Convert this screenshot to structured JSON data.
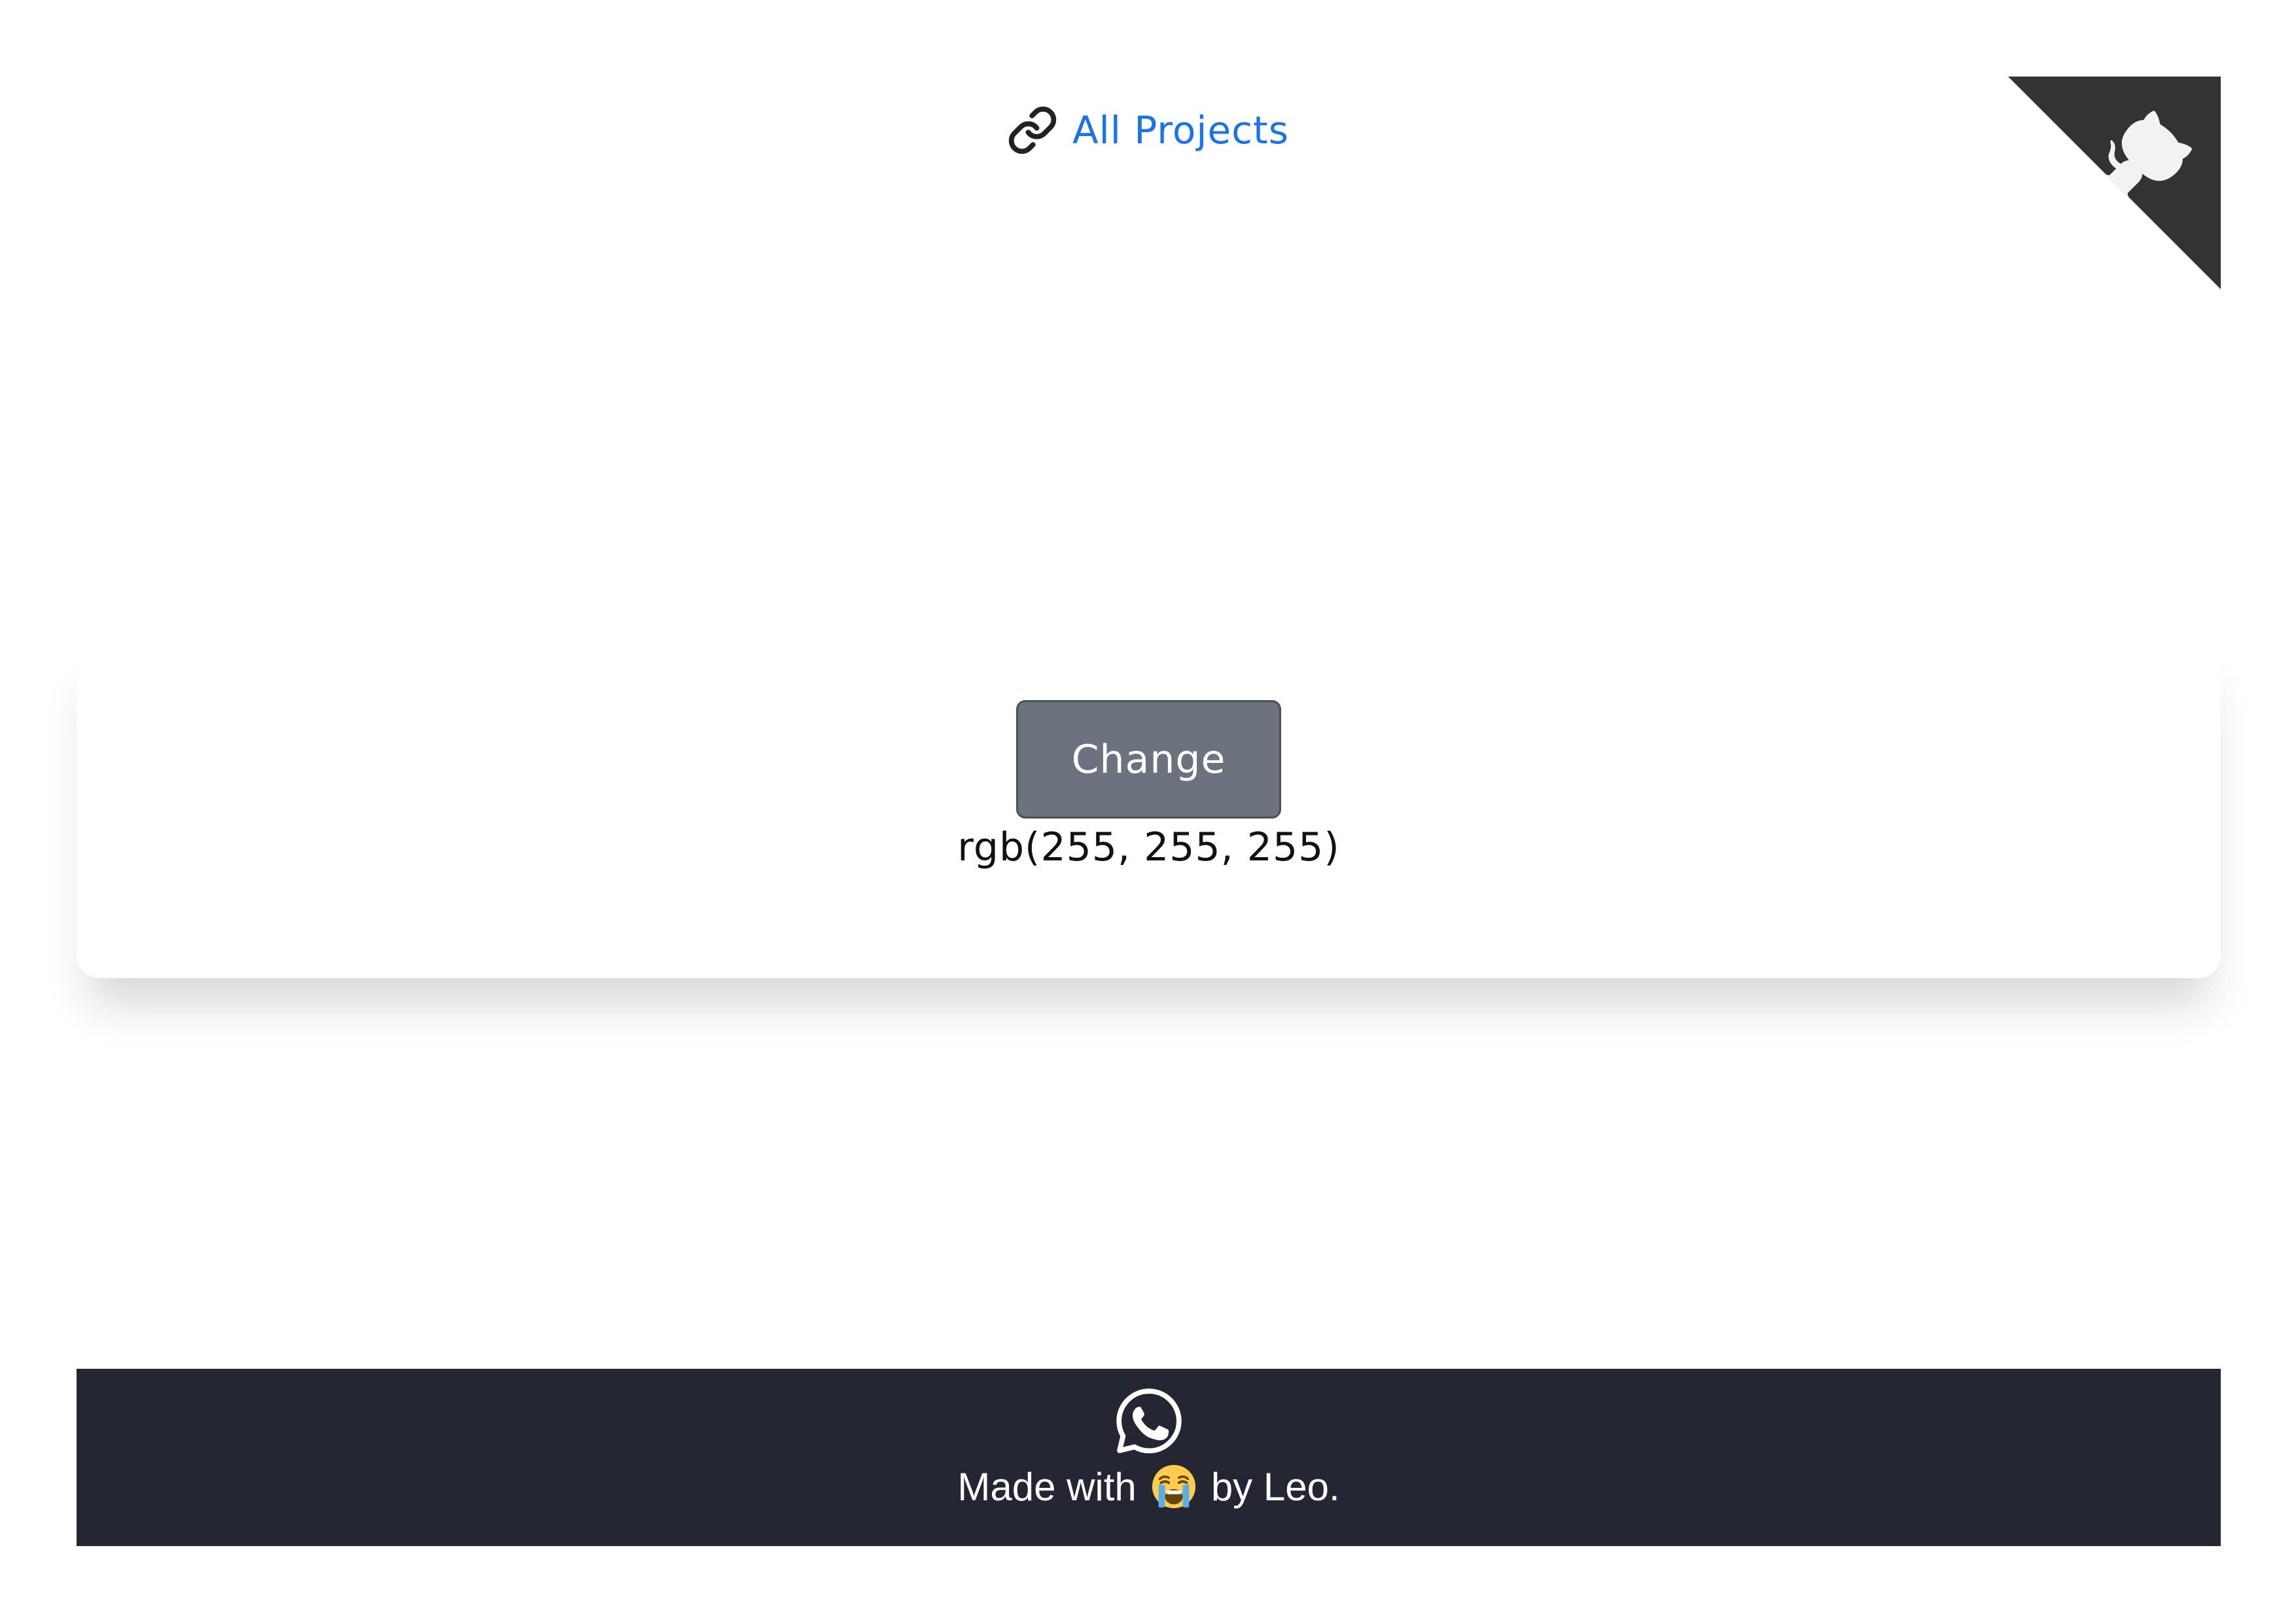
{
  "nav": {
    "link_label": "All Projects",
    "link_icon": "link-icon",
    "link_color": "#1a73e8"
  },
  "github_corner": {
    "icon": "github-octocat-icon",
    "background_color": "#333333"
  },
  "card": {
    "button_label": "Change",
    "button_color": "#6c737e",
    "color_value": "rgb(255, 255, 255)"
  },
  "footer": {
    "icon": "whatsapp-icon",
    "made_with": "Made with",
    "emoji": "loudly-crying-face",
    "by_text": "by Leo.",
    "background_color": "#242633"
  }
}
